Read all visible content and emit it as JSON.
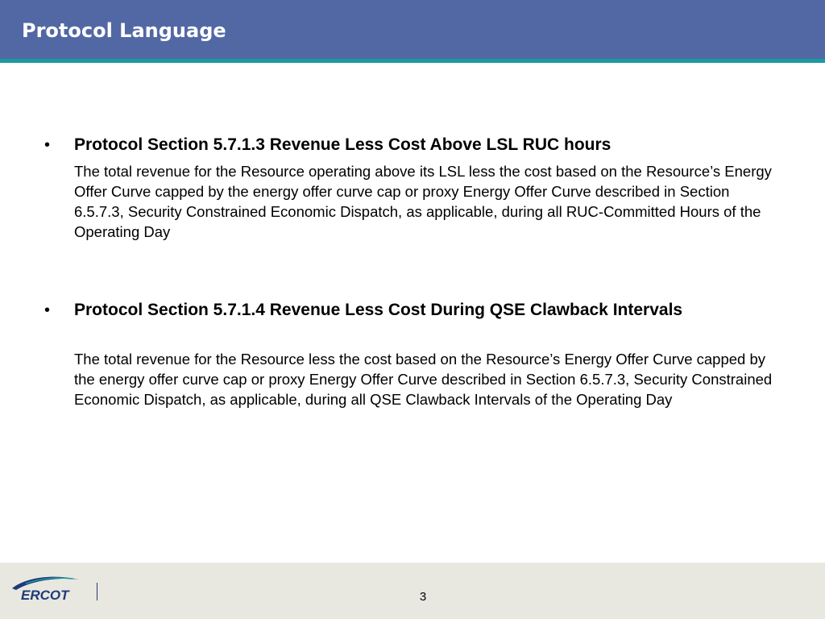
{
  "header": {
    "title": "Protocol Language"
  },
  "bullets": [
    {
      "heading": "Protocol Section 5.7.1.3 Revenue Less Cost Above LSL RUC hours",
      "body": "The total revenue for the Resource operating above its LSL less the cost based on the Resource’s Energy Offer Curve capped by the energy offer curve cap or proxy Energy Offer Curve described in Section 6.5.7.3, Security Constrained Economic Dispatch, as applicable, during all RUC-Committed Hours of the Operating Day"
    },
    {
      "heading": "Protocol Section 5.7.1.4 Revenue Less Cost During QSE Clawback Intervals",
      "body": "The total revenue for the Resource less the cost based on the Resource’s Energy Offer Curve capped by the energy offer curve cap or proxy Energy Offer Curve described in Section 6.5.7.3, Security Constrained Economic Dispatch, as applicable, during all QSE Clawback Intervals of the Operating Day"
    }
  ],
  "footer": {
    "logo_text": "ERCOT",
    "page_number": "3"
  },
  "colors": {
    "header_bg": "#5268a4",
    "header_rule": "#1c9aa0",
    "footer_bg": "#e8e8e0",
    "logo_blue": "#1f3a7a",
    "logo_teal": "#1c9aa0"
  },
  "icons": {
    "bullet": "•",
    "logo": "ercot-logo-icon"
  }
}
